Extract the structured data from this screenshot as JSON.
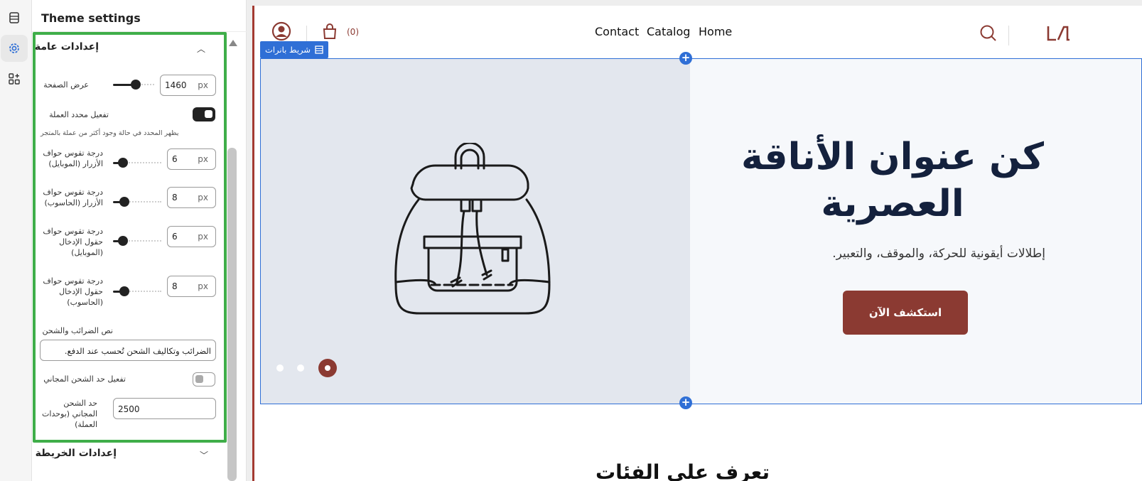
{
  "panel": {
    "title": "Theme settings"
  },
  "general_section": {
    "title": "إعدادات عامة",
    "page_width": {
      "label": "عرض الصفحة",
      "value": "1460",
      "unit": "px",
      "level": 0.55
    },
    "currency_selector": {
      "label": "تفعيل محدد العملة",
      "hint": "يظهر المحدد في حالة وجود أكثر من عملة بالمتجر",
      "enabled": true
    },
    "button_radius_mobile": {
      "label": "درجة تقوس حواف الأزرار (الموبايل)",
      "value": "6",
      "unit": "px",
      "level": 0.15
    },
    "button_radius_desktop": {
      "label": "درجة تقوس حواف الأزرار (الحاسوب)",
      "value": "8",
      "unit": "px",
      "level": 0.2
    },
    "input_radius_mobile": {
      "label": "درجة تقوس حواف حقول الإدخال (الموبايل)",
      "value": "6",
      "unit": "px",
      "level": 0.15
    },
    "input_radius_desktop": {
      "label": "درجة تقوس حواف حقول الإدخال (الحاسوب)",
      "value": "8",
      "unit": "px",
      "level": 0.2
    },
    "tax_shipping_text": {
      "label": "نص الضرائب والشحن",
      "value": "الضرائب وتكاليف الشحن تُحسب عند الدفع."
    },
    "free_shipping": {
      "label": "تفعيل حد الشحن المجاني",
      "enabled": false
    },
    "free_shipping_threshold": {
      "label": "حد الشحن المجاني (بوحدات العملة)",
      "value": "2500"
    }
  },
  "map_section": {
    "title": "إعدادات الخريطة"
  },
  "preview": {
    "cart_count": "(0)",
    "nav": [
      "Contact",
      "Catalog",
      "Home"
    ],
    "section_badge": "شريط بانرات",
    "hero_title": "كن عنوان الأناقة العصرية",
    "hero_subtitle": "إطلالات أيقونية للحركة، والموقف، والتعبير.",
    "hero_button": "استكشف الآن",
    "next_section_title": "تعرف على الفئات"
  },
  "colors": {
    "accent": "#8b3a32",
    "selection_blue": "#2f6fd6",
    "highlight_green": "#3fae49"
  },
  "icons": [
    "layers-icon",
    "gear-icon",
    "add-blocks-icon",
    "user-icon",
    "cart-icon",
    "search-icon",
    "logo",
    "grid-handle-icon",
    "chevron-up-icon",
    "chevron-down-icon"
  ]
}
